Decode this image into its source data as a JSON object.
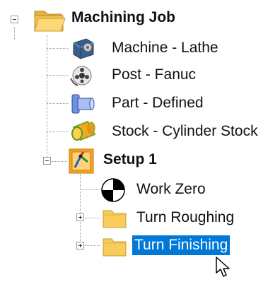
{
  "tree": {
    "root": {
      "label": "Machining Job",
      "expanded": true,
      "icon": "folder-open-icon"
    },
    "children": [
      {
        "label": "Machine - Lathe",
        "icon": "machine-icon"
      },
      {
        "label": "Post - Fanuc",
        "icon": "post-processor-icon"
      },
      {
        "label": "Part - Defined",
        "icon": "part-icon"
      },
      {
        "label": "Stock - Cylinder Stock",
        "icon": "stock-cylinder-icon"
      }
    ],
    "setup": {
      "label": "Setup 1",
      "expanded": true,
      "icon": "setup-icon",
      "children": [
        {
          "label": "Work Zero",
          "icon": "work-zero-icon"
        },
        {
          "label": "Turn Roughing",
          "icon": "folder-icon",
          "collapsed": true
        },
        {
          "label": "Turn Finishing",
          "icon": "folder-icon",
          "collapsed": true,
          "selected": true
        }
      ]
    }
  },
  "colors": {
    "selection": "#0078d7",
    "folder": "#f7cc5a",
    "tree_lines": "#9a9a9a"
  }
}
